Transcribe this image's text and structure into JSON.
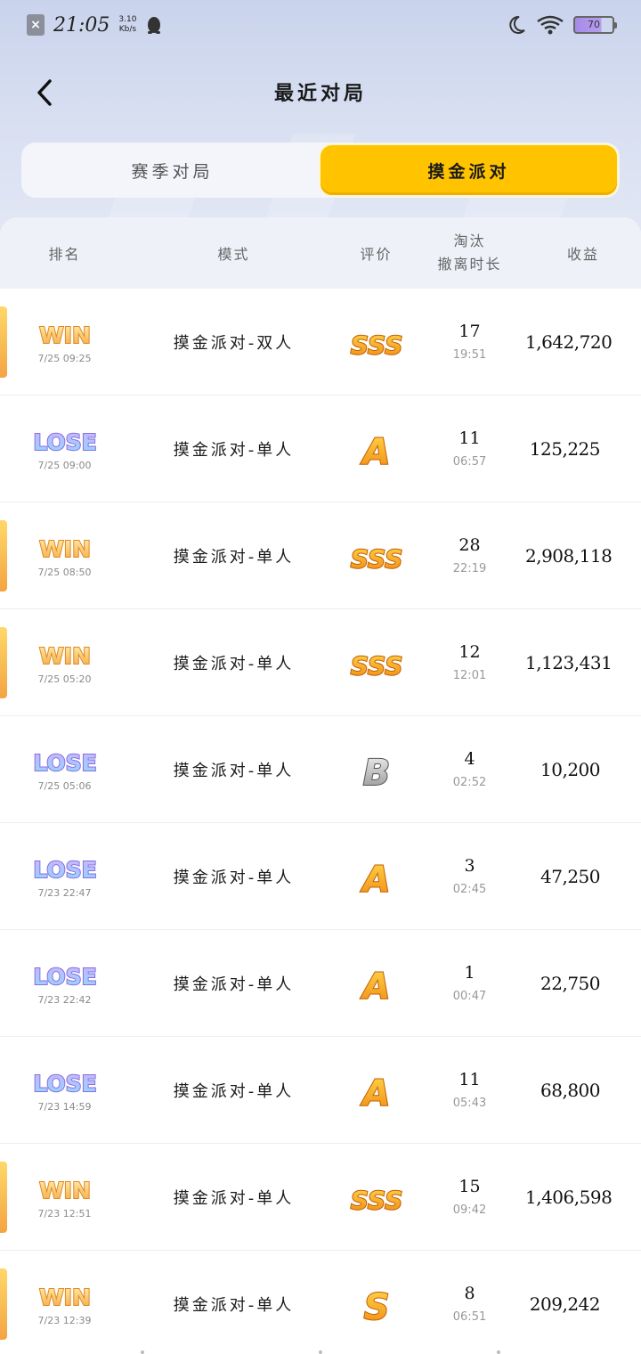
{
  "status_bar": {
    "time": "21:05",
    "net_speed_value": "3.10",
    "net_speed_unit": "Kb/s",
    "battery": "70"
  },
  "header": {
    "title": "最近对局"
  },
  "tabs": [
    {
      "label": "赛季对局",
      "active": false
    },
    {
      "label": "摸金派对",
      "active": true
    }
  ],
  "columns": {
    "rank": "排名",
    "mode": "模式",
    "rating": "评价",
    "elim_line1": "淘汰",
    "elim_line2": "撤离时长",
    "earnings": "收益"
  },
  "colors": {
    "accent": "#ffc300",
    "win_bar": "#f3a443",
    "lose_text": "#9b7fe6"
  },
  "matches": [
    {
      "result": "WIN",
      "time": "7/25 09:25",
      "mode": "摸金派对-双人",
      "grade": "SSS",
      "kills": "17",
      "duration": "19:51",
      "earnings": "1,642,720"
    },
    {
      "result": "LOSE",
      "time": "7/25 09:00",
      "mode": "摸金派对-单人",
      "grade": "A",
      "kills": "11",
      "duration": "06:57",
      "earnings": "125,225"
    },
    {
      "result": "WIN",
      "time": "7/25 08:50",
      "mode": "摸金派对-单人",
      "grade": "SSS",
      "kills": "28",
      "duration": "22:19",
      "earnings": "2,908,118"
    },
    {
      "result": "WIN",
      "time": "7/25 05:20",
      "mode": "摸金派对-单人",
      "grade": "SSS",
      "kills": "12",
      "duration": "12:01",
      "earnings": "1,123,431"
    },
    {
      "result": "LOSE",
      "time": "7/25 05:06",
      "mode": "摸金派对-单人",
      "grade": "B",
      "kills": "4",
      "duration": "02:52",
      "earnings": "10,200"
    },
    {
      "result": "LOSE",
      "time": "7/23 22:47",
      "mode": "摸金派对-单人",
      "grade": "A",
      "kills": "3",
      "duration": "02:45",
      "earnings": "47,250"
    },
    {
      "result": "LOSE",
      "time": "7/23 22:42",
      "mode": "摸金派对-单人",
      "grade": "A",
      "kills": "1",
      "duration": "00:47",
      "earnings": "22,750"
    },
    {
      "result": "LOSE",
      "time": "7/23 14:59",
      "mode": "摸金派对-单人",
      "grade": "A",
      "kills": "11",
      "duration": "05:43",
      "earnings": "68,800"
    },
    {
      "result": "WIN",
      "time": "7/23 12:51",
      "mode": "摸金派对-单人",
      "grade": "SSS",
      "kills": "15",
      "duration": "09:42",
      "earnings": "1,406,598"
    },
    {
      "result": "WIN",
      "time": "7/23 12:39",
      "mode": "摸金派对-单人",
      "grade": "S",
      "kills": "8",
      "duration": "06:51",
      "earnings": "209,242"
    }
  ]
}
